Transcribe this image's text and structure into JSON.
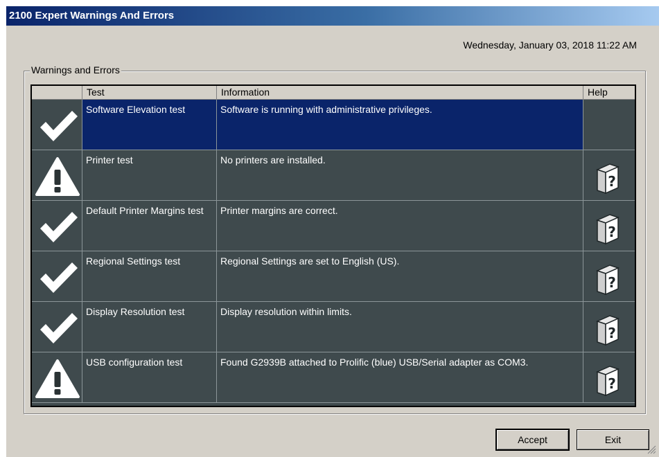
{
  "window": {
    "title": "2100 Expert Warnings And Errors",
    "datetime": "Wednesday, January 03, 2018 11:22 AM"
  },
  "group": {
    "label": "Warnings and Errors"
  },
  "table": {
    "columns": {
      "icon": "",
      "test": "Test",
      "information": "Information",
      "help": "Help"
    },
    "rows": [
      {
        "status": "check-icon",
        "test": "Software Elevation test",
        "information": "Software is running with administrative privileges.",
        "has_help": false,
        "selected": true
      },
      {
        "status": "warning-icon",
        "test": "Printer test",
        "information": "No printers are installed.",
        "has_help": true,
        "selected": false
      },
      {
        "status": "check-icon",
        "test": "Default Printer Margins test",
        "information": "Printer margins are correct.",
        "has_help": true,
        "selected": false
      },
      {
        "status": "check-icon",
        "test": "Regional Settings test",
        "information": "Regional Settings are set to English (US).",
        "has_help": true,
        "selected": false
      },
      {
        "status": "check-icon",
        "test": "Display Resolution test",
        "information": "Display resolution within limits.",
        "has_help": true,
        "selected": false
      },
      {
        "status": "warning-icon",
        "test": "USB configuration test",
        "information": "Found G2939B attached to Prolific (blue) USB/Serial adapter as COM3.",
        "has_help": true,
        "selected": false
      }
    ]
  },
  "buttons": {
    "accept": "Accept",
    "exit": "Exit"
  },
  "colors": {
    "grid_background": "#3f4a4d",
    "selection": "#0a246a",
    "titlebar": "#0a246a",
    "dialog": "#d4d0c8"
  }
}
